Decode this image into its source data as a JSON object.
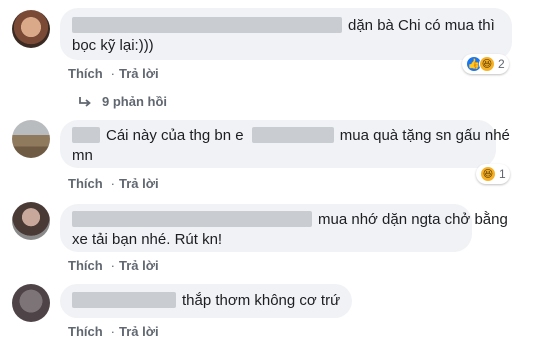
{
  "comments": [
    {
      "text_line1": "dặn bà Chi có mua thì",
      "text_line2": "bọc kỹ lại:)))",
      "like_label": "Thích",
      "reply_label": "Trả lời",
      "reaction_count": "2",
      "reactions": [
        "like-icon",
        "haha-icon"
      ]
    },
    {
      "text_prefix": "Cái này của thg bn e",
      "text_suffix": "mua quà tặng sn gấu nhé",
      "text_line2": "mn",
      "like_label": "Thích",
      "reply_label": "Trả lời",
      "reaction_count": "1",
      "reactions": [
        "haha-icon"
      ]
    },
    {
      "text_line1": "mua nhớ dặn ngta chở bằng",
      "text_line2": "xe tải bạn nhé. Rút kn!",
      "like_label": "Thích",
      "reply_label": "Trả lời"
    },
    {
      "text_line1": "thắp thơm không cơ trứ",
      "like_label": "Thích",
      "reply_label": "Trả lời"
    }
  ],
  "replies_link": "9 phản hồi",
  "colors": {
    "bubble_bg": "#f0f2f5",
    "action_text": "#606770",
    "like_blue": "#1877f2",
    "haha_yellow": "#f7b125"
  }
}
